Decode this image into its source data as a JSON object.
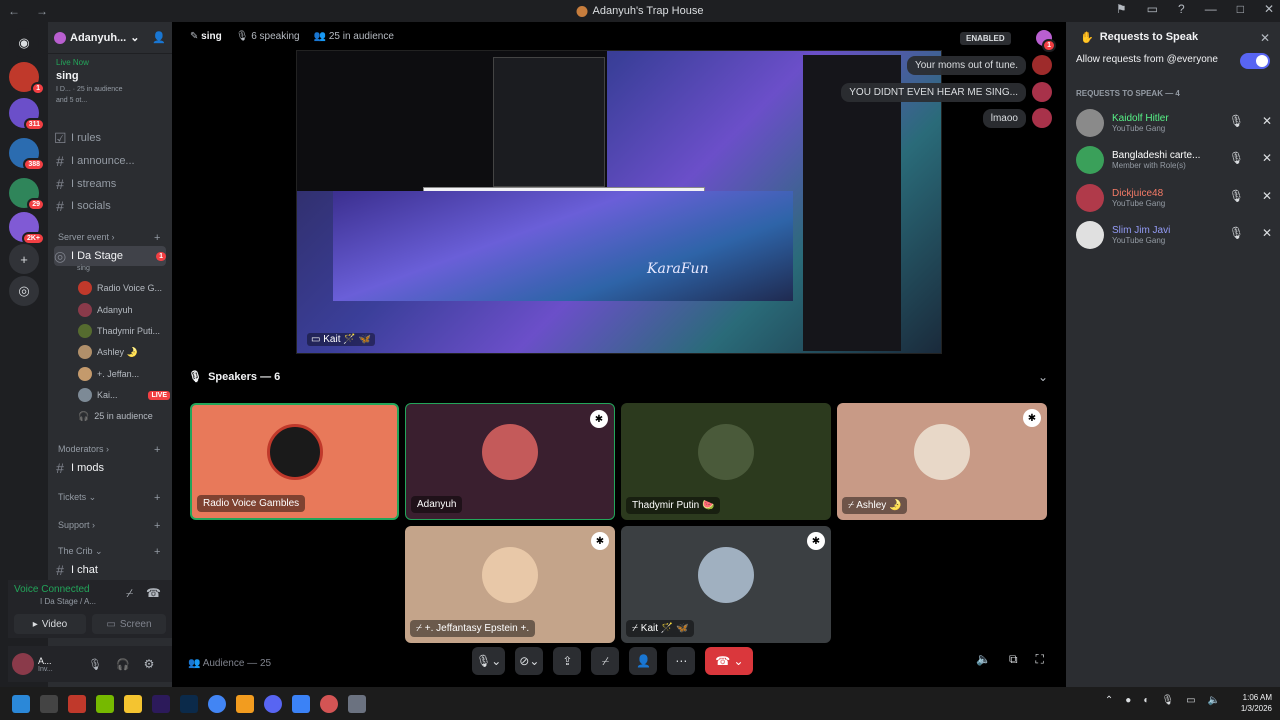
{
  "window": {
    "title": "Adanyuh's Trap House"
  },
  "rail": {
    "badges": [
      "1",
      "311",
      "388",
      "29",
      "2K+"
    ]
  },
  "server": {
    "name": "Adanyuh..."
  },
  "live_now": {
    "label": "Live Now",
    "stage": "sing",
    "info1": "I D...",
    "info2": "25 in audience",
    "info3": "and 5 ot..."
  },
  "channels": [
    {
      "name": "I rules"
    },
    {
      "name": "I announce..."
    },
    {
      "name": "I streams"
    },
    {
      "name": "I socials"
    }
  ],
  "categories": {
    "server_event": "Server event",
    "moderators": "Moderators",
    "tickets": "Tickets",
    "support": "Support",
    "the_crib": "The Crib"
  },
  "stage_channel": {
    "name": "I Da Stage",
    "topic": "sing",
    "badge": "1"
  },
  "stage_users": [
    {
      "name": "Radio Voice G..."
    },
    {
      "name": "Adanyuh"
    },
    {
      "name": "Thadymir Puti..."
    },
    {
      "name": "Ashley 🌛"
    },
    {
      "name": "+. Jeffan..."
    },
    {
      "name": "Kai...",
      "live": "LIVE"
    }
  ],
  "audience_count": "25 in audience",
  "mods_channel": "I mods",
  "chat_channel": "I chat",
  "voice": {
    "status": "Voice Connected",
    "location": "I Da Stage / A...",
    "video": "Video",
    "screen": "Screen"
  },
  "user": {
    "name": "A...",
    "status": "Inv..."
  },
  "stage_header": {
    "topic": "sing",
    "speaking": "6 speaking",
    "audience": "25 in audience",
    "enabled": "ENABLED",
    "badge": "1"
  },
  "stream": {
    "caption": "Kait 🪄 🦋",
    "logo": "KaraFun"
  },
  "chat": [
    {
      "text": "Your moms out of tune."
    },
    {
      "text": "YOU DIDNT EVEN HEAR ME SING..."
    },
    {
      "text": "lmaoo"
    }
  ],
  "speakers_header": "Speakers — 6",
  "speakers": [
    {
      "name": "Radio Voice Gambles",
      "bg": "#e8795a"
    },
    {
      "name": "Adanyuh",
      "bg": "#3a1f2f"
    },
    {
      "name": "Thadymir Putin 🍉",
      "bg": "#2c3a1e"
    },
    {
      "name": "Ashley 🌛",
      "bg": "#c89a86"
    },
    {
      "name": "+. Jeffantasy Epstein +.",
      "bg": "#c4a48a"
    },
    {
      "name": "Kait 🪄 🦋",
      "bg": "#3b3f42"
    }
  ],
  "audience_footer": "Audience — 25",
  "right_panel": {
    "title": "Requests to Speak",
    "allow_label": "Allow requests from @everyone",
    "list_header": "REQUESTS TO SPEAK — 4",
    "requests": [
      {
        "name": "Kaidolf Hitler",
        "role": "YouTube Gang",
        "color": "#57f287"
      },
      {
        "name": "Bangladeshi carte...",
        "role": "Member with Role(s)",
        "color": "#ffffff"
      },
      {
        "name": "Dickjuice48",
        "role": "YouTube Gang",
        "color": "#f47b67"
      },
      {
        "name": "Slim Jim Javi",
        "role": "YouTube Gang",
        "color": "#949cf7"
      }
    ]
  },
  "clock": {
    "time": "1:06 AM",
    "date": "1/3/2026"
  }
}
